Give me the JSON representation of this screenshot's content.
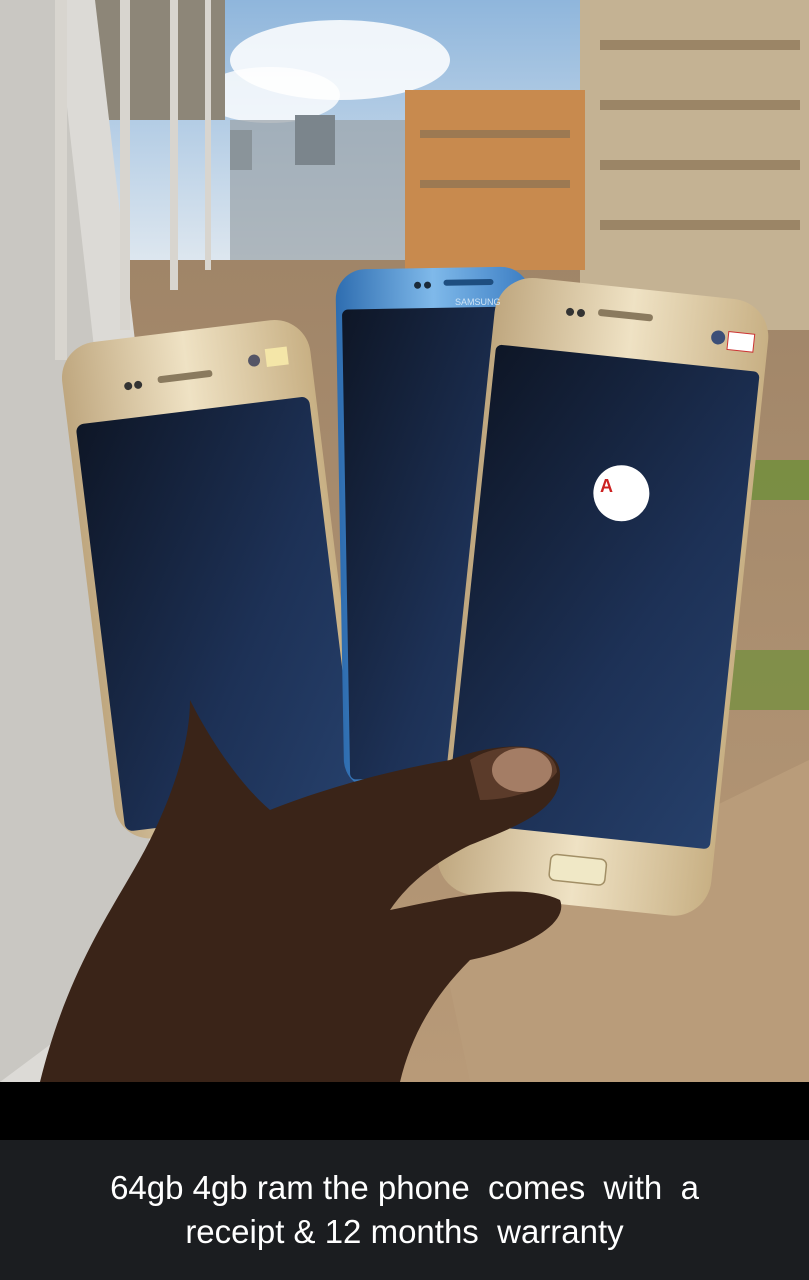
{
  "viewer": {
    "photo_subject": "hand holding three smartphones",
    "overlay_text": {
      "phone_brand": "SAMSUNG",
      "sticker_mark": "A"
    }
  },
  "caption": {
    "text": "64gb 4gb ram the phone  comes  with  a\nreceipt & 12 months  warranty"
  },
  "colors": {
    "caption_bg": "#1b1d20",
    "caption_text": "#ffffff",
    "sky": "#cfe0ef",
    "phone_gold": "#d9c9a4",
    "phone_blue": "#4a8fd0",
    "screen": "#16213a",
    "skin": "#3a2418"
  }
}
